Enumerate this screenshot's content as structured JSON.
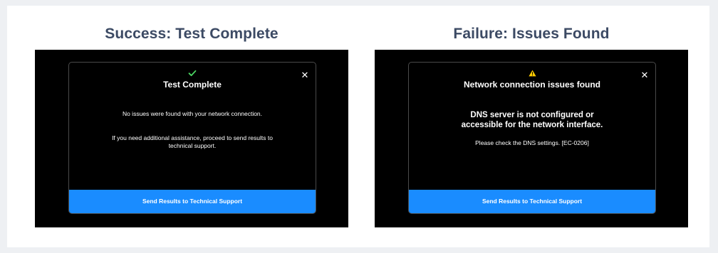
{
  "success": {
    "heading": "Success: Test Complete",
    "dialog": {
      "status_icon": "checkmark-icon",
      "status_color": "#4cd964",
      "title": "Test Complete",
      "message": "No issues were found with your network connection.",
      "assistance": "If you need additional assistance, proceed to send results to technical support.",
      "close_label": "✕",
      "button_label": "Send Results to Technical Support"
    }
  },
  "failure": {
    "heading": "Failure: Issues Found",
    "dialog": {
      "status_icon": "warning-icon",
      "status_color": "#ffcc00",
      "title": "Network connection issues found",
      "error_headline": "DNS server is not configured or accessible for the network interface.",
      "error_detail": "Please check the DNS settings. [EC-0206]",
      "close_label": "✕",
      "button_label": "Send Results to Technical Support"
    }
  },
  "colors": {
    "heading": "#3c4a64",
    "button": "#1a8cff",
    "screen": "#000000"
  }
}
